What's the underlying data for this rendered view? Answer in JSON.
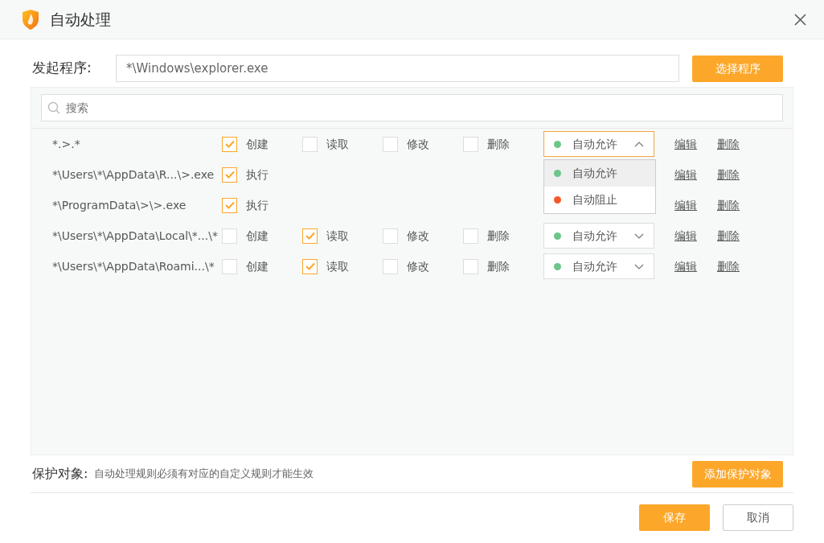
{
  "window": {
    "title": "自动处理"
  },
  "program": {
    "label": "发起程序:",
    "value": "*\\Windows\\explorer.exe",
    "button": "选择程序"
  },
  "search": {
    "placeholder": "搜索"
  },
  "rules": [
    {
      "path": "*.>.*",
      "permissions": [
        {
          "label": "创建",
          "checked": true
        },
        {
          "label": "读取",
          "checked": false
        },
        {
          "label": "修改",
          "checked": false
        },
        {
          "label": "删除",
          "checked": false
        }
      ],
      "action": {
        "label": "自动允许",
        "color": "#6cc689",
        "expanded": true
      },
      "edit": "编辑",
      "delete": "删除"
    },
    {
      "path": "*\\Users\\*\\AppData\\R...\\>.exe",
      "permissions": [
        {
          "label": "执行",
          "checked": true
        }
      ],
      "edit": "编辑",
      "delete": "删除"
    },
    {
      "path": "*\\ProgramData\\>\\>.exe",
      "permissions": [
        {
          "label": "执行",
          "checked": true
        }
      ],
      "edit": "编辑",
      "delete": "删除"
    },
    {
      "path": "*\\Users\\*\\AppData\\Local\\*...\\*",
      "permissions": [
        {
          "label": "创建",
          "checked": false
        },
        {
          "label": "读取",
          "checked": true
        },
        {
          "label": "修改",
          "checked": false
        },
        {
          "label": "删除",
          "checked": false
        }
      ],
      "action": {
        "label": "自动允许",
        "color": "#6cc689",
        "expanded": false
      },
      "edit": "编辑",
      "delete": "删除"
    },
    {
      "path": "*\\Users\\*\\AppData\\Roami...\\*",
      "permissions": [
        {
          "label": "创建",
          "checked": false
        },
        {
          "label": "读取",
          "checked": true
        },
        {
          "label": "修改",
          "checked": false
        },
        {
          "label": "删除",
          "checked": false
        }
      ],
      "action": {
        "label": "自动允许",
        "color": "#6cc689",
        "expanded": false
      },
      "edit": "编辑",
      "delete": "删除"
    }
  ],
  "action_menu": {
    "options": [
      {
        "label": "自动允许",
        "color": "#6cc689",
        "selected": true
      },
      {
        "label": "自动阻止",
        "color": "#f5582a",
        "selected": false
      }
    ]
  },
  "protect": {
    "label": "保护对象:",
    "hint": "自动处理规则必须有对应的自定义规则才能生效",
    "button": "添加保护对象"
  },
  "footer": {
    "save": "保存",
    "cancel": "取消"
  }
}
